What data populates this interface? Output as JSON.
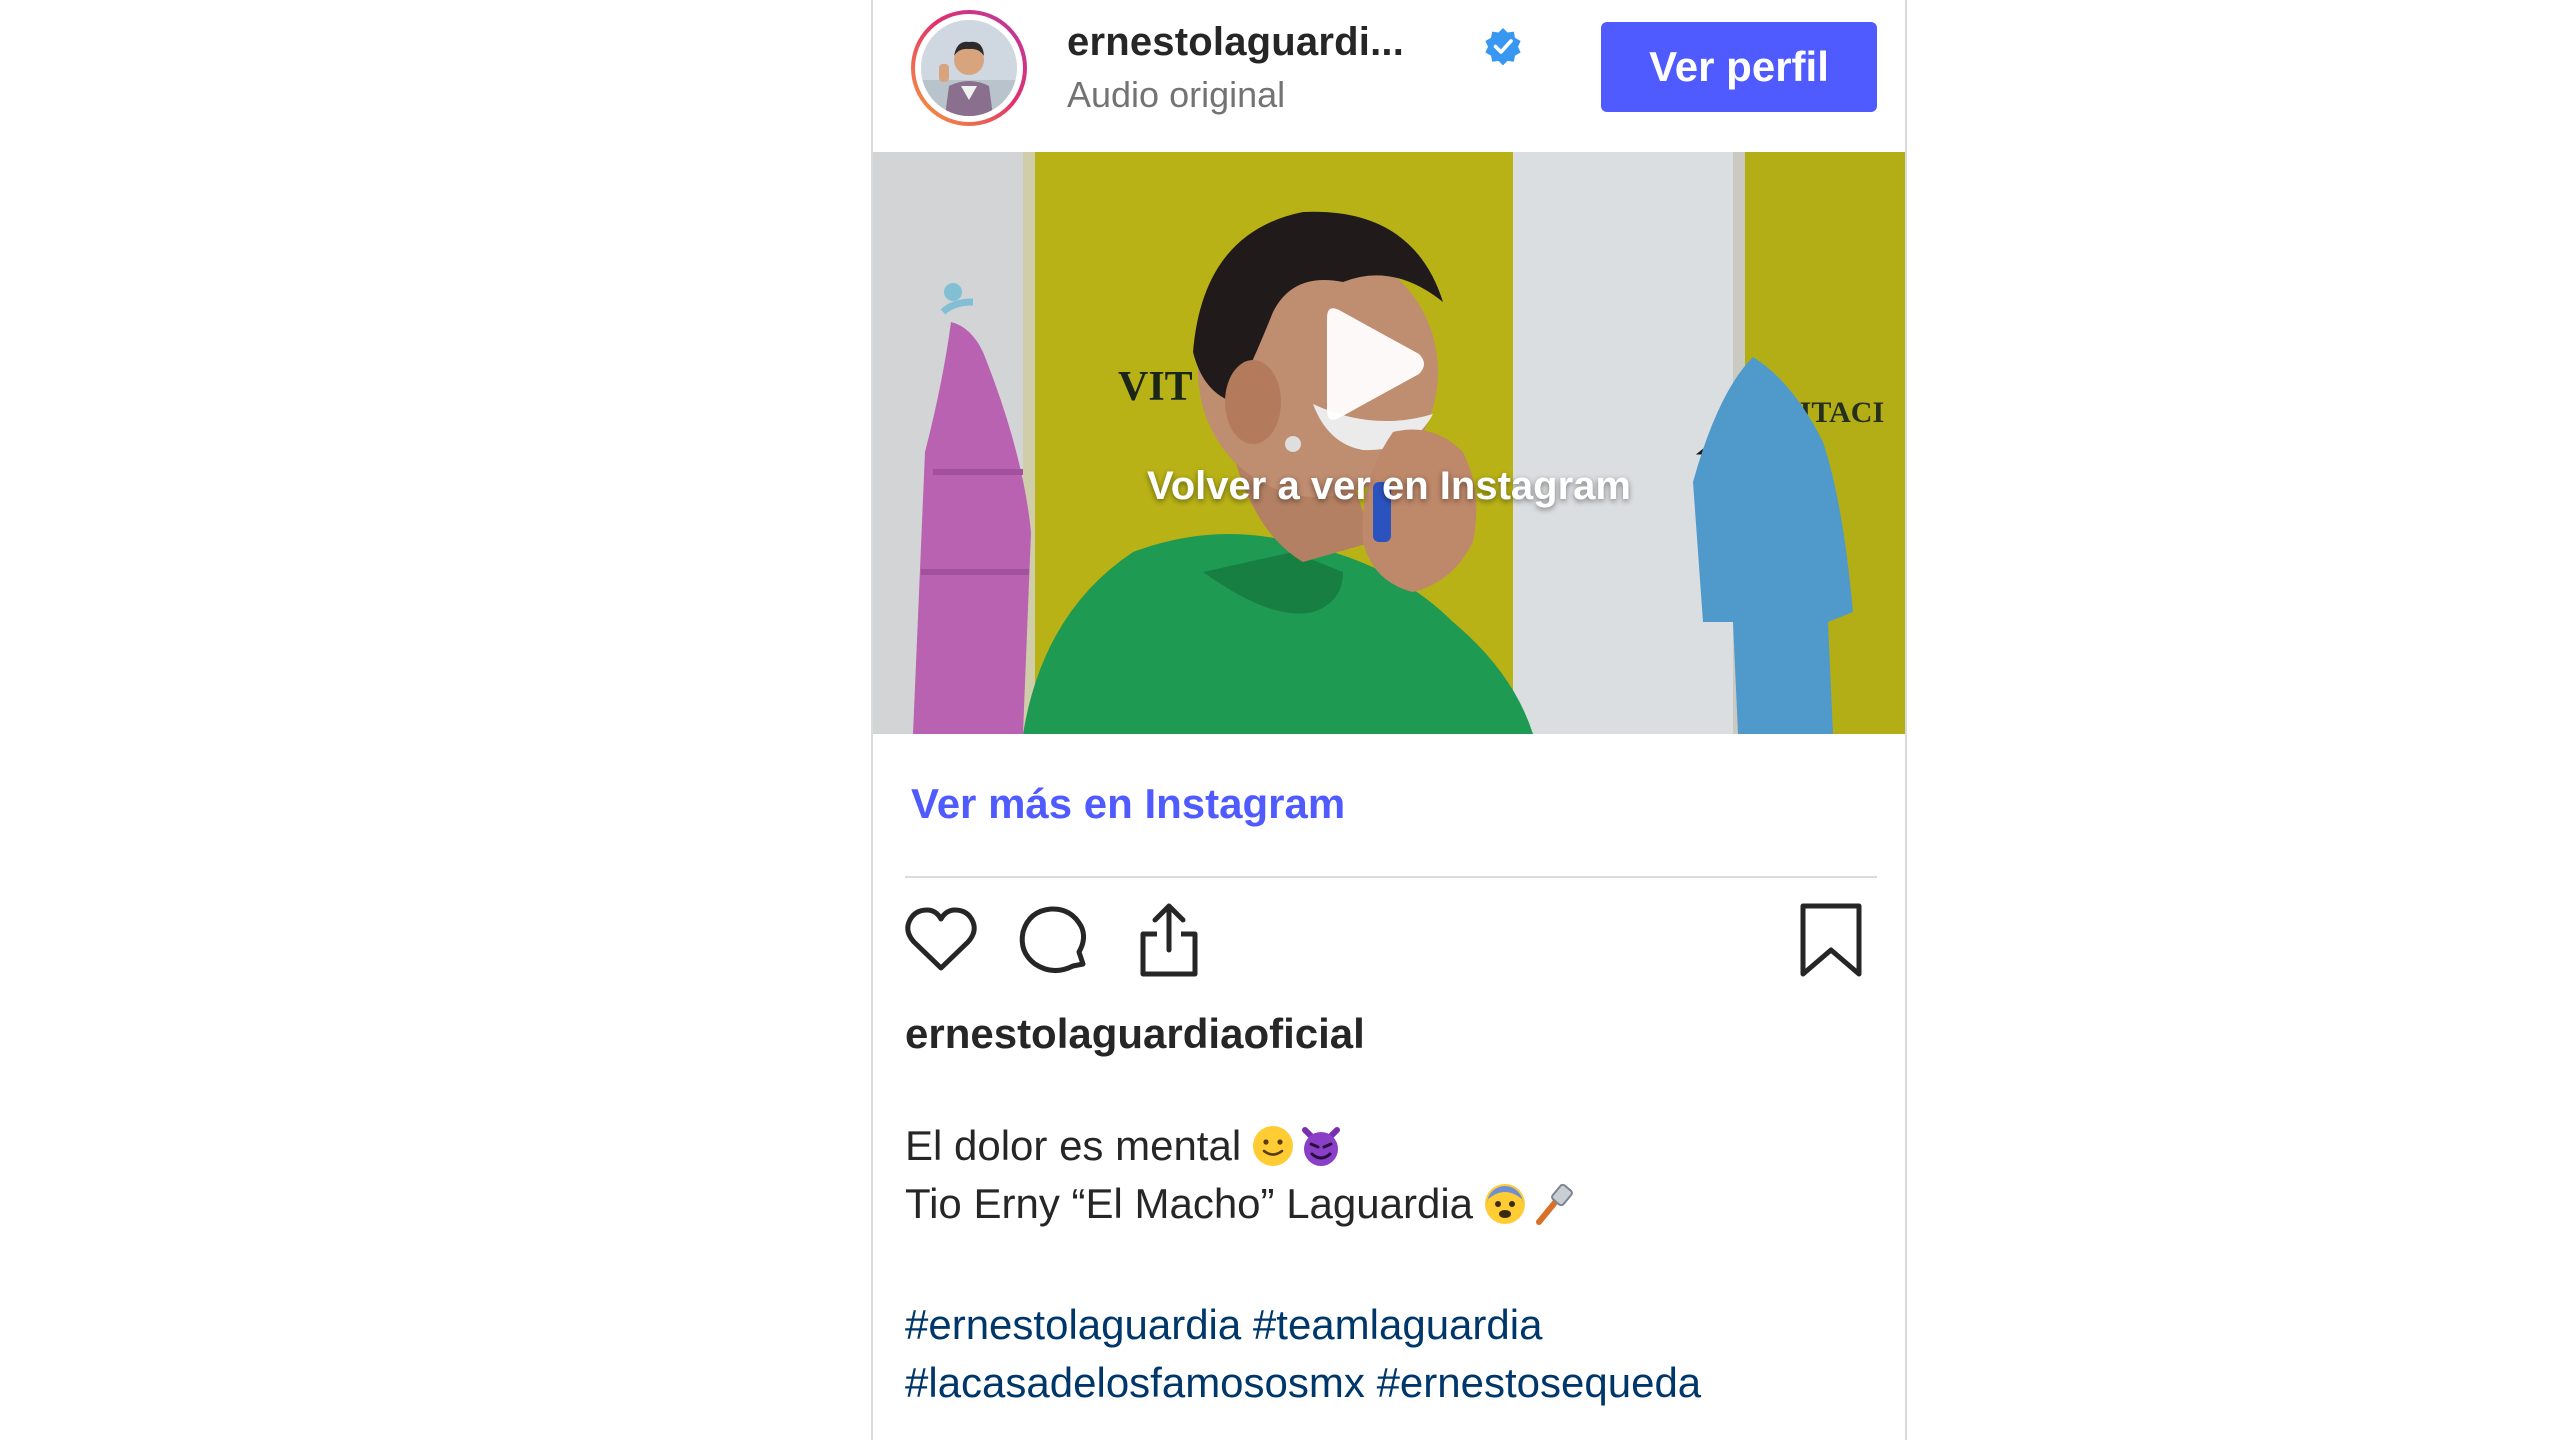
{
  "header": {
    "username": "ernestolaguardi...",
    "subtitle": "Audio original",
    "verified_icon": "verified-badge-icon",
    "profile_button": "Ver perfil"
  },
  "media": {
    "overlay_text": "Volver a ver en Instagram",
    "play_icon": "play-icon",
    "wall_sign_left": "VIT",
    "wall_sign_right": "VITACI"
  },
  "more_link": "Ver más en Instagram",
  "actions": {
    "like": "heart-icon",
    "comment": "comment-icon",
    "share": "share-icon",
    "save": "bookmark-icon"
  },
  "caption": {
    "username": "ernestolaguardiaoficial",
    "line1": "El dolor es mental",
    "line1_emojis": [
      "slightly-smiling-face",
      "smiling-devil"
    ],
    "line2": "Tio Erny “El Macho” Laguardia",
    "line2_emojis": [
      "fearful-face",
      "razor"
    ],
    "hashtags_line1": [
      "#ernestolaguardia",
      "#teamlaguardia"
    ],
    "hashtags_line2": [
      "#lacasadelosfamososmx",
      "#ernestosequeda"
    ]
  },
  "colors": {
    "accent": "#4f5bff",
    "hashtag": "#00376b",
    "secondary_text": "#737373",
    "divider": "#dbdbdb"
  }
}
